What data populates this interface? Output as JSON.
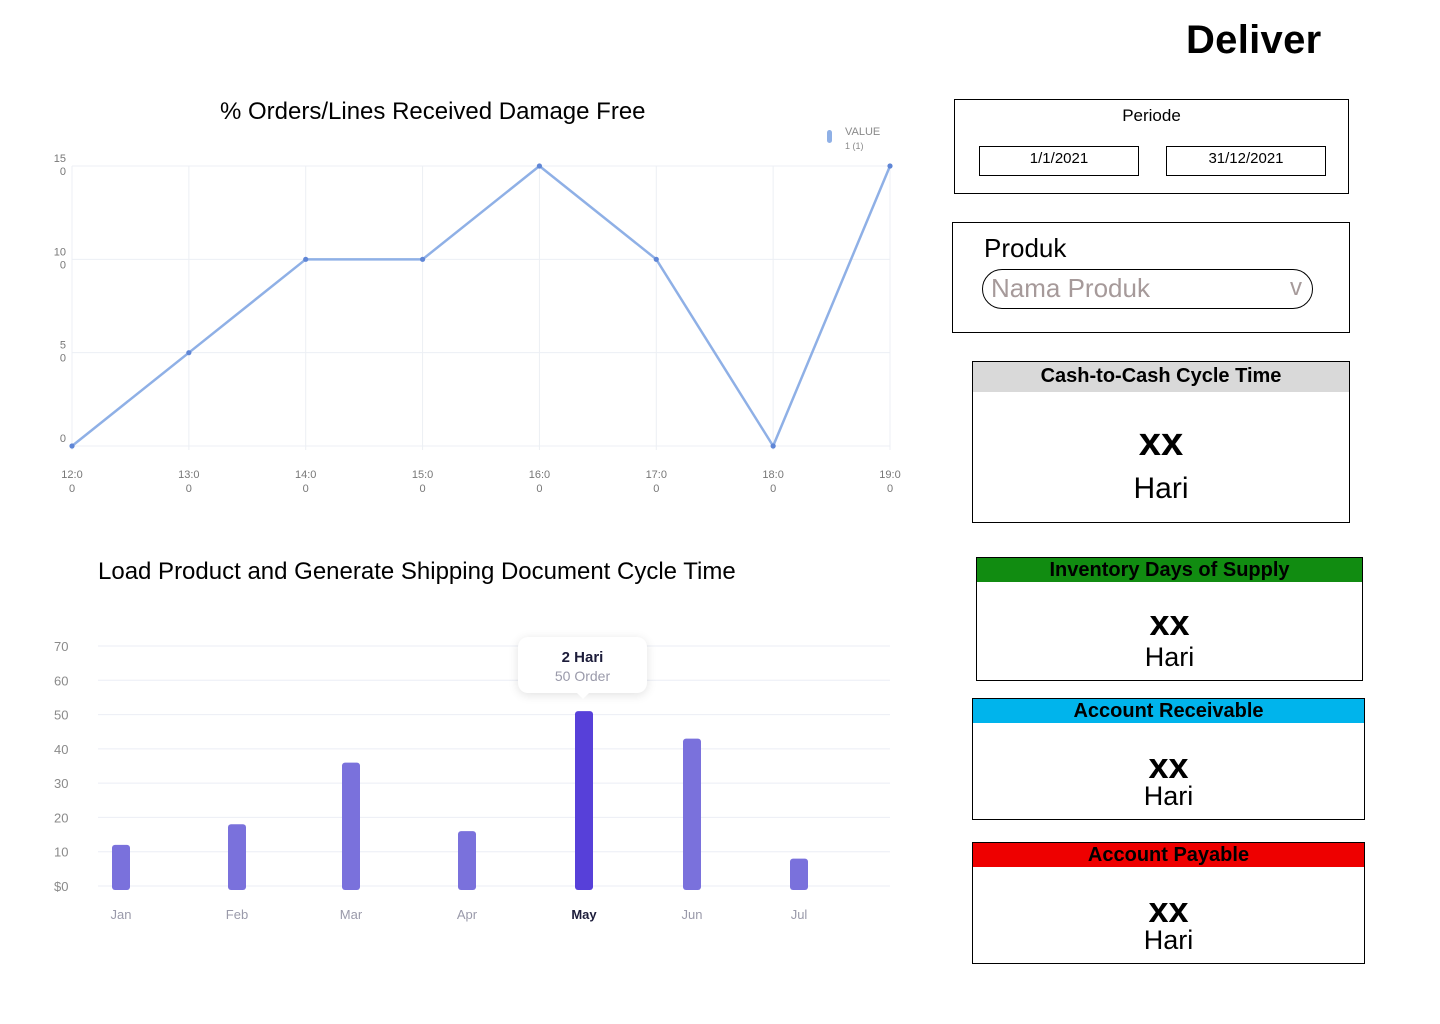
{
  "page": {
    "title": "Deliver"
  },
  "filters": {
    "periode_label": "Periode",
    "start_date": "1/1/2021",
    "end_date": "31/12/2021",
    "produk_label": "Produk",
    "produk_placeholder": "Nama Produk",
    "produk_chevron": "v"
  },
  "metrics": [
    {
      "title": "Cash-to-Cash Cycle Time",
      "value": "xx",
      "unit": "Hari",
      "color": "#d9d9d9"
    },
    {
      "title": "Inventory Days of Supply",
      "value": "xx",
      "unit": "Hari",
      "color": "#118c11"
    },
    {
      "title": "Account Receivable",
      "value": "xx",
      "unit": "Hari",
      "color": "#00b4ec"
    },
    {
      "title": "Account Payable",
      "value": "xx",
      "unit": "Hari",
      "color": "#ee0000"
    }
  ],
  "charts": {
    "line_title": "% Orders/Lines Received Damage Free",
    "bar_title": "Load Product and Generate Shipping Document Cycle Time",
    "tooltip": {
      "value": "2 Hari",
      "detail": "50 Order"
    }
  },
  "chart_data": [
    {
      "type": "line",
      "title": "% Orders/Lines Received Damage Free",
      "x": [
        "12:00",
        "13:00",
        "14:00",
        "15:00",
        "16:00",
        "17:00",
        "18:00",
        "19:00"
      ],
      "x_tick_labels": [
        [
          "12:0",
          "0"
        ],
        [
          "13:0",
          "0"
        ],
        [
          "14:0",
          "0"
        ],
        [
          "15:0",
          "0"
        ],
        [
          "16:0",
          "0"
        ],
        [
          "17:0",
          "0"
        ],
        [
          "18:0",
          "0"
        ],
        [
          "19:0",
          "0"
        ]
      ],
      "series": [
        {
          "name": "VALUE",
          "values": [
            0,
            50,
            100,
            100,
            150,
            100,
            0,
            150
          ]
        }
      ],
      "legend": {
        "label": "VALUE",
        "sub": "1 (1)",
        "position": "top-right"
      },
      "y_ticks": [
        0,
        50,
        100,
        150
      ],
      "y_tick_labels": [
        [
          "0"
        ],
        [
          "5",
          "0"
        ],
        [
          "10",
          "0"
        ],
        [
          "15",
          "0"
        ]
      ],
      "ylim": [
        0,
        150
      ],
      "grid": true,
      "color": "#8fb0e6"
    },
    {
      "type": "bar",
      "title": "Load Product and Generate Shipping Document Cycle Time",
      "categories": [
        "Jan",
        "Feb",
        "Mar",
        "Apr",
        "May",
        "Jun",
        "Jul"
      ],
      "values": [
        12,
        18,
        36,
        16,
        51,
        43,
        8
      ],
      "highlight": "May",
      "y_ticks": [
        0,
        10,
        20,
        30,
        40,
        50,
        60,
        70
      ],
      "y_tick_labels": [
        "$0",
        "10",
        "20",
        "30",
        "40",
        "50",
        "60",
        "70"
      ],
      "ylim": [
        0,
        70
      ],
      "grid": true,
      "color": "#7a71dc",
      "highlight_color": "#5740d9"
    }
  ]
}
